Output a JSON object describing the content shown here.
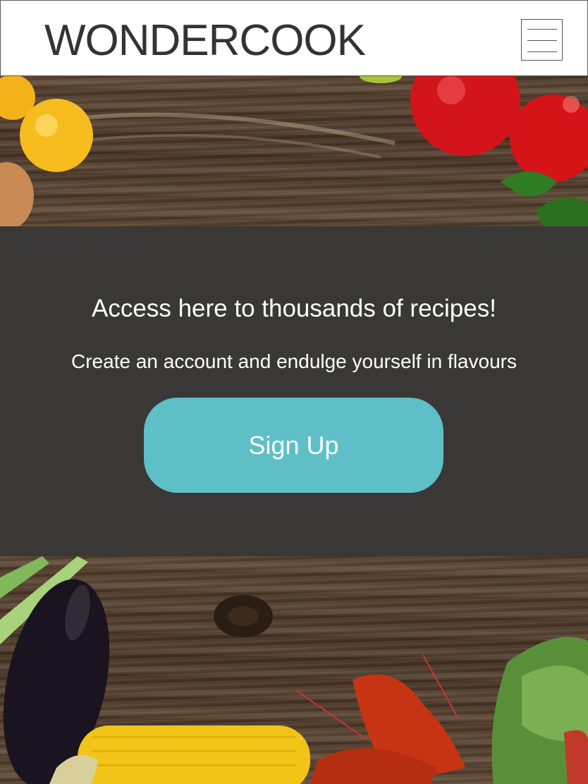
{
  "header": {
    "brand": "WONDERCOOK",
    "menu_icon": "hamburger-menu-icon"
  },
  "hero_top": {
    "image": "wooden-table-with-tomatoes-and-lemons"
  },
  "cta": {
    "headline": "Access here to thousands of recipes!",
    "subline": "Create an account and endulge yourself in flavours",
    "button_label": "Sign Up"
  },
  "hero_bottom": {
    "image": "wooden-table-with-eggplant-corn-crayfish-lettuce"
  },
  "colors": {
    "header_bg": "#ffffff",
    "brand_text": "#333333",
    "band_bg": "#3a3737",
    "button_bg": "#5fbfc7",
    "button_text": "#ffffff"
  }
}
